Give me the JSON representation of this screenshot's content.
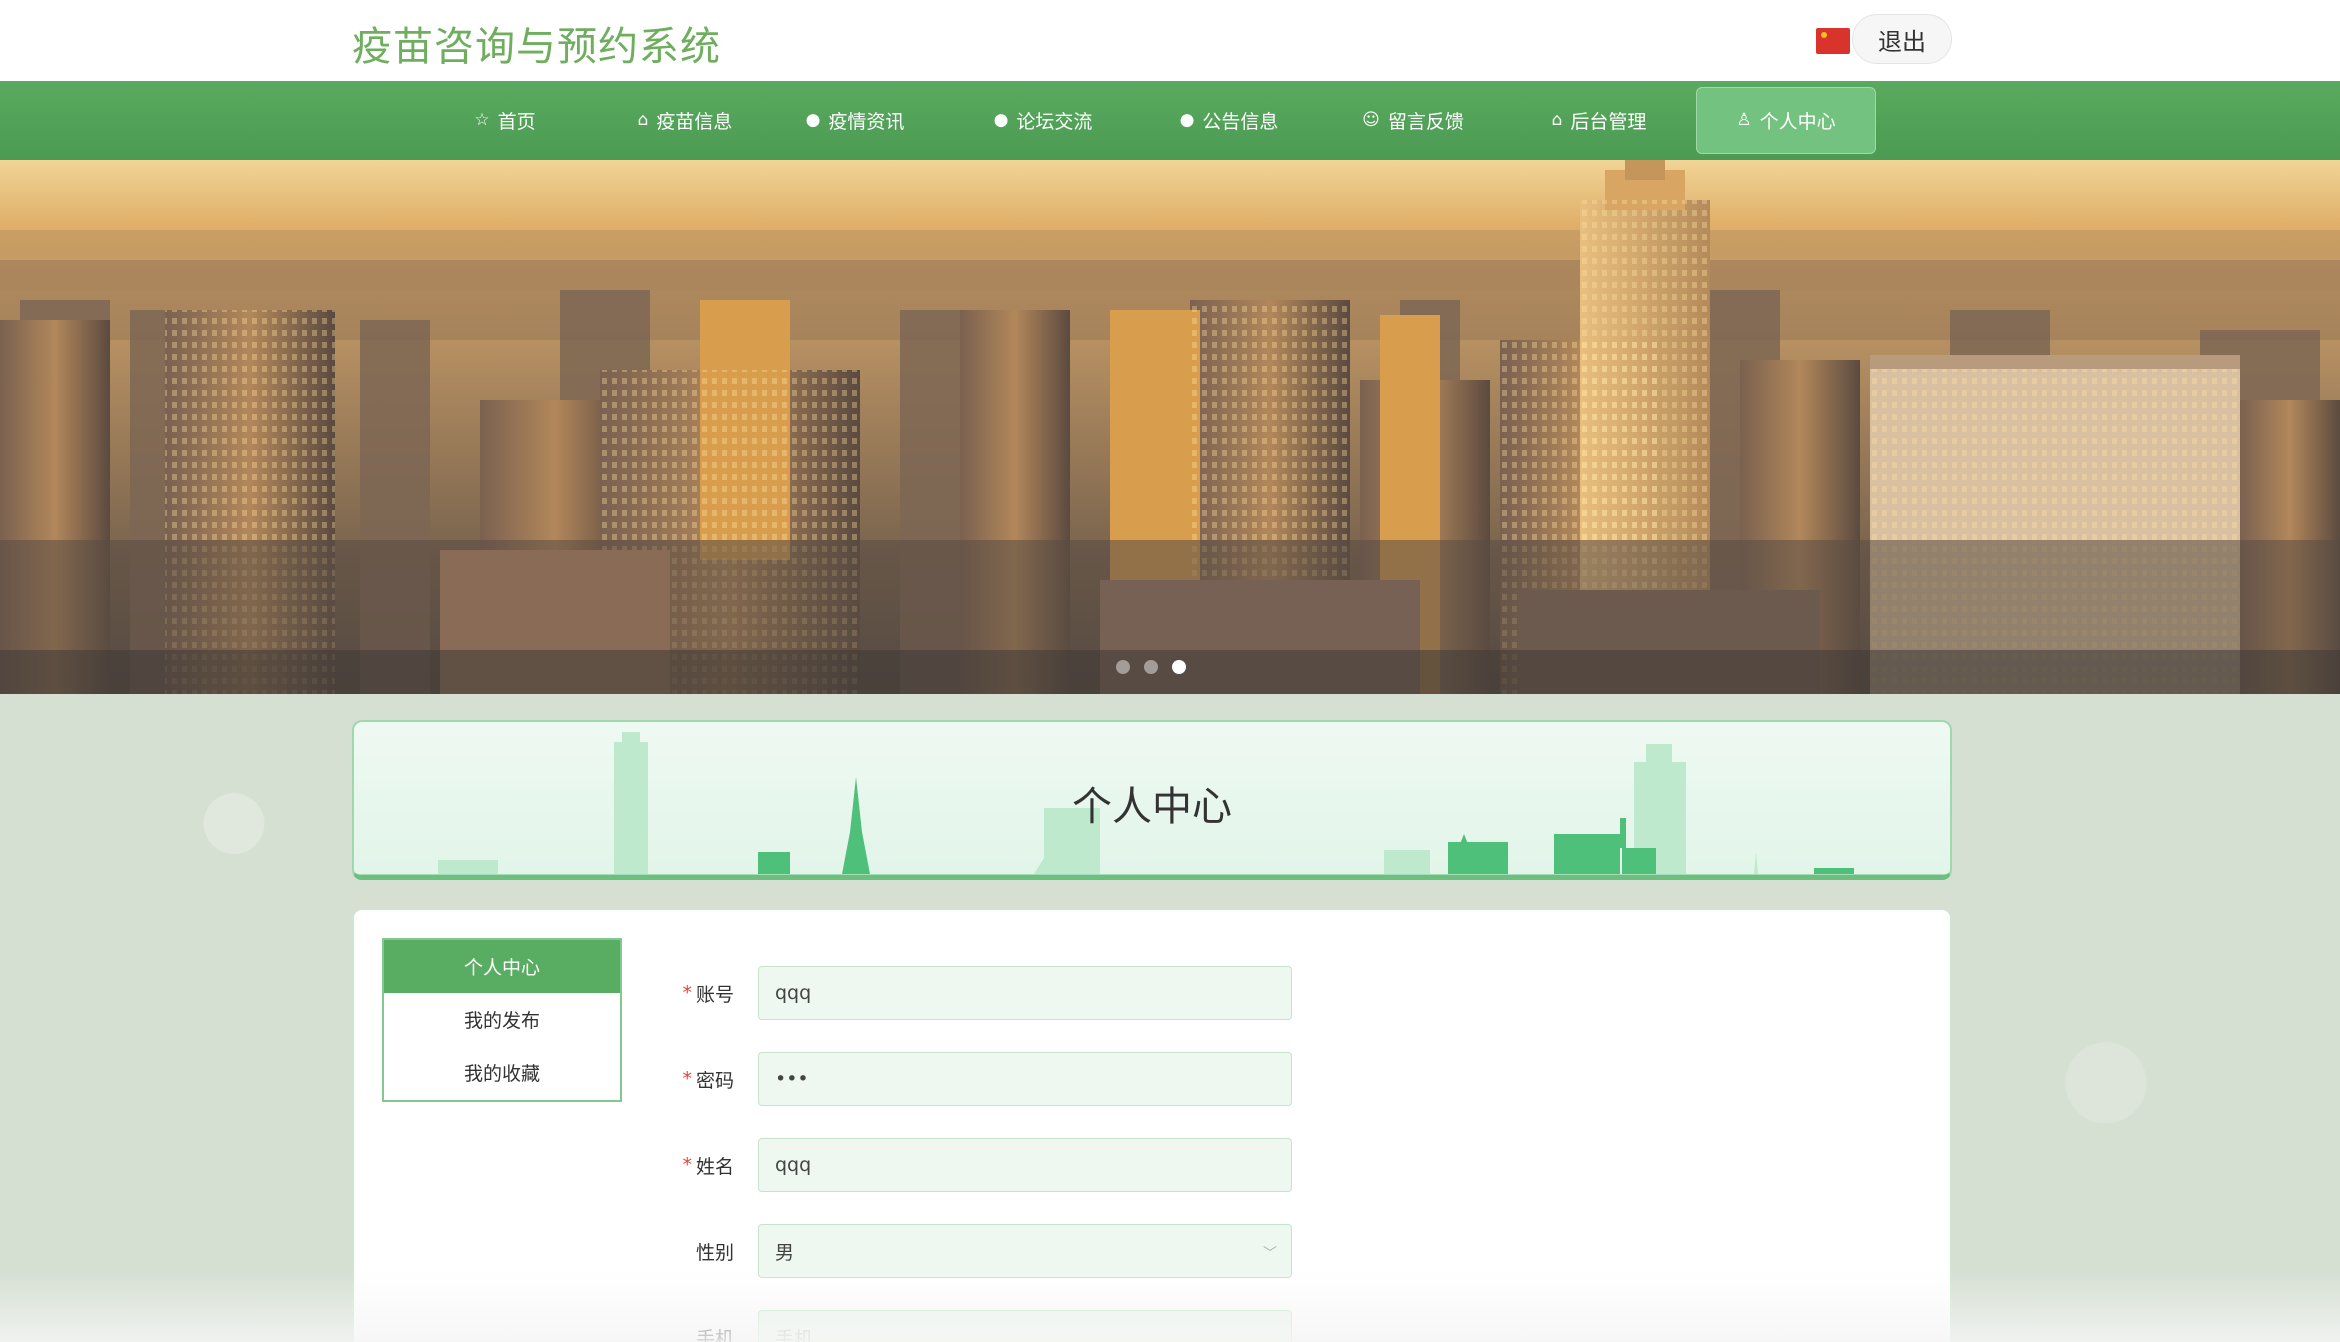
{
  "header": {
    "site_title": "疫苗咨询与预约系统",
    "logout_label": "退出",
    "flag_icon": "china-flag-icon"
  },
  "nav": {
    "items": [
      {
        "label": "首页",
        "icon": "star-icon",
        "glyph": "☆"
      },
      {
        "label": "疫苗信息",
        "icon": "bag-icon",
        "glyph": "⌂"
      },
      {
        "label": "疫情资讯",
        "icon": "info-circle-icon",
        "glyph": "●"
      },
      {
        "label": "论坛交流",
        "icon": "question-circle-icon",
        "glyph": "●"
      },
      {
        "label": "公告信息",
        "icon": "info-circle-icon",
        "glyph": "●"
      },
      {
        "label": "留言反馈",
        "icon": "smile-icon",
        "glyph": "☺"
      },
      {
        "label": "后台管理",
        "icon": "shop-icon",
        "glyph": "⌂"
      },
      {
        "label": "个人中心",
        "icon": "user-icon",
        "glyph": "♙"
      }
    ],
    "active_index": 7
  },
  "banner": {
    "slides": 3,
    "active_slide": 3
  },
  "title_card": {
    "title": "个人中心"
  },
  "side_menu": {
    "items": [
      "个人中心",
      "我的发布",
      "我的收藏"
    ],
    "active_index": 0
  },
  "form": {
    "account": {
      "label": "账号",
      "required": true,
      "value": "qqq"
    },
    "password": {
      "label": "密码",
      "required": true,
      "value": "•••"
    },
    "name": {
      "label": "姓名",
      "required": true,
      "value": "qqq"
    },
    "gender": {
      "label": "性别",
      "required": false,
      "value": "男"
    },
    "phone": {
      "label": "手机",
      "required": false,
      "placeholder": "手机"
    }
  },
  "colors": {
    "brand_green": "#59aa5f",
    "title_green": "#6fae5e",
    "required_red": "#e0463d"
  }
}
